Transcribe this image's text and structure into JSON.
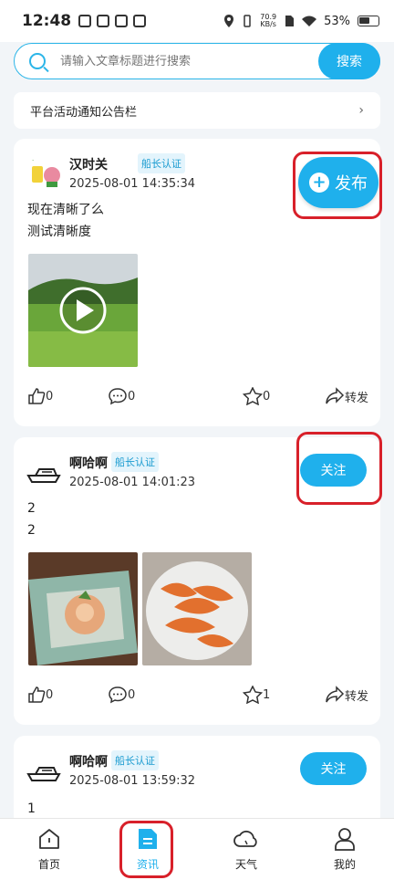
{
  "status_bar": {
    "time": "12:48",
    "speed_value": "70.9",
    "speed_unit": "KB/s",
    "battery": "53%"
  },
  "search": {
    "placeholder": "请输入文章标题进行搜索",
    "button_label": "搜索"
  },
  "notice": {
    "label": "平台活动通知公告栏",
    "chevron": "›"
  },
  "publish_button": {
    "label": "发布"
  },
  "posts": [
    {
      "username": "汉时关",
      "badge": "船长认证",
      "timestamp": "2025-08-01 14:35:34",
      "content_lines": [
        "现在清晰了么",
        "测试清晰度"
      ],
      "like_count": "0",
      "comment_count": "0",
      "favorite_count": "0",
      "share_label": "转发"
    },
    {
      "username": "啊哈啊",
      "badge": "船长认证",
      "timestamp": "2025-08-01 14:01:23",
      "follow_label": "关注",
      "content_lines": [
        "2",
        "2"
      ],
      "like_count": "0",
      "comment_count": "0",
      "favorite_count": "1",
      "share_label": "转发"
    },
    {
      "username": "啊哈啊",
      "badge": "船长认证",
      "timestamp": "2025-08-01 13:59:32",
      "follow_label": "关注",
      "content_lines": [
        "1"
      ]
    }
  ],
  "tabs": [
    {
      "label": "首页",
      "icon": "home-icon"
    },
    {
      "label": "资讯",
      "icon": "news-icon",
      "active": true
    },
    {
      "label": "天气",
      "icon": "cloud-icon"
    },
    {
      "label": "我的",
      "icon": "user-icon"
    }
  ],
  "colors": {
    "accent": "#1fb0ec",
    "highlight_box": "#d8202a"
  }
}
